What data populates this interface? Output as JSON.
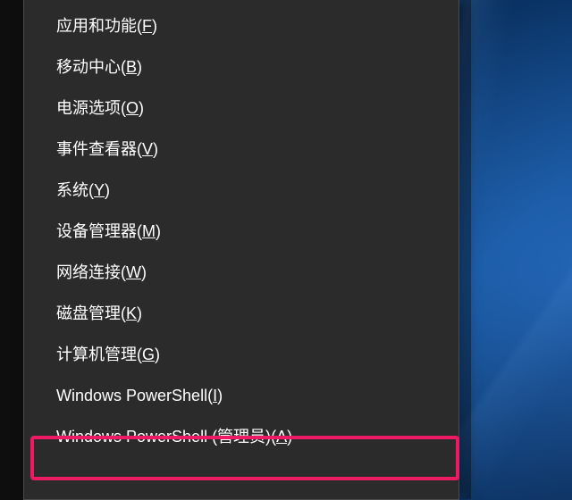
{
  "menu": {
    "items": [
      {
        "label": "应用和功能",
        "key": "F"
      },
      {
        "label": "移动中心",
        "key": "B"
      },
      {
        "label": "电源选项",
        "key": "O"
      },
      {
        "label": "事件查看器",
        "key": "V"
      },
      {
        "label": "系统",
        "key": "Y"
      },
      {
        "label": "设备管理器",
        "key": "M"
      },
      {
        "label": "网络连接",
        "key": "W"
      },
      {
        "label": "磁盘管理",
        "key": "K"
      },
      {
        "label": "计算机管理",
        "key": "G"
      },
      {
        "label": "Windows PowerShell",
        "key": "I"
      },
      {
        "label": "Windows PowerShell (管理员)",
        "key": "A"
      }
    ],
    "highlighted_index": 10
  },
  "colors": {
    "highlight": "#ec1a63",
    "menu_bg": "#2b2b2b"
  }
}
